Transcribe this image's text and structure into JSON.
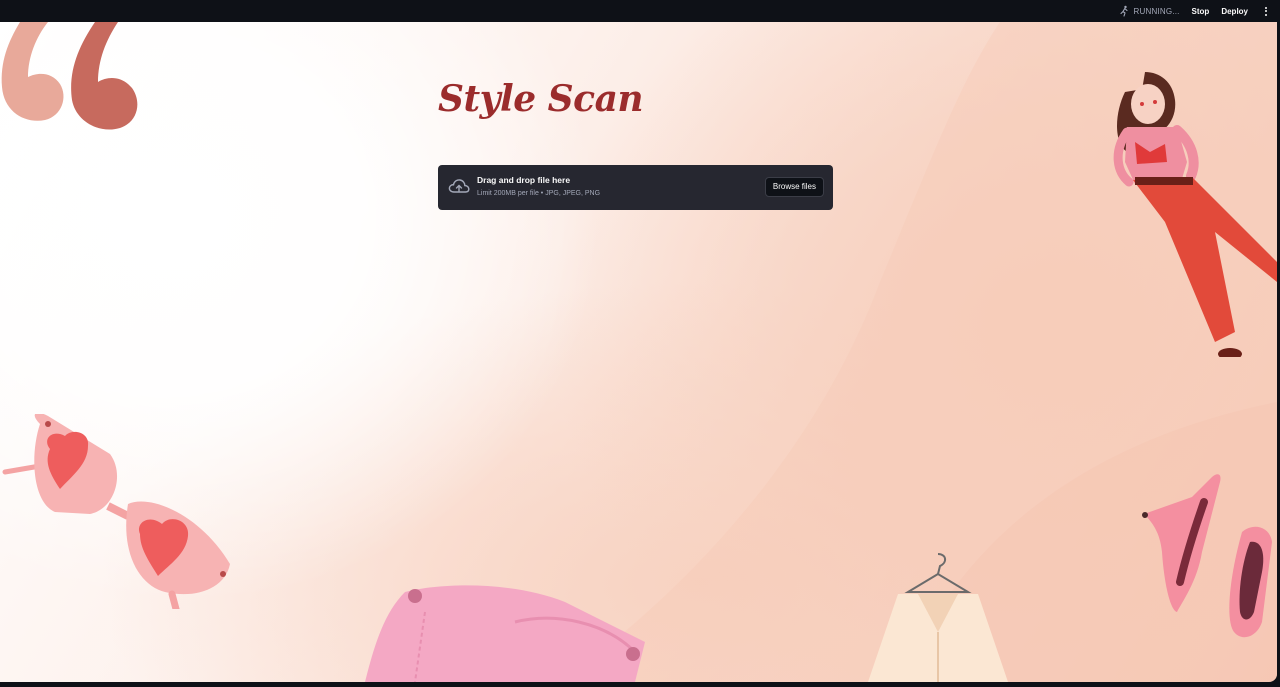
{
  "topbar": {
    "status": "RUNNING...",
    "stop_label": "Stop",
    "deploy_label": "Deploy",
    "running_icon": "running-person-icon",
    "menu_icon": "kebab-menu-icon"
  },
  "main": {
    "title": "Style Scan",
    "uploader": {
      "primary_text": "Drag and drop file here",
      "secondary_text": "Limit 200MB per file • JPG, JPEG, PNG",
      "browse_label": "Browse files",
      "icon": "cloud-upload-icon"
    }
  },
  "colors": {
    "title": "#9b2c2c",
    "uploader_bg": "#262730",
    "topbar_bg": "#0e1117",
    "accent_pink": "#f28b8b"
  },
  "decorations": [
    "quote-mark-icon",
    "fashion-girl-illustration",
    "heart-sunglasses-illustration",
    "pink-bag-illustration",
    "blouse-on-hanger-illustration",
    "high-heels-illustration"
  ]
}
